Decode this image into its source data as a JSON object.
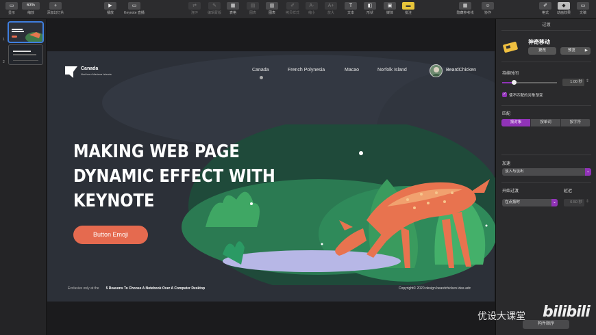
{
  "toolbar": {
    "items": [
      {
        "label": "显示",
        "icon": "view-icon"
      },
      {
        "label": "缩放",
        "value": "63%"
      },
      {
        "label": "添加幻灯片",
        "icon": "plus-icon"
      },
      {
        "label": "播放",
        "icon": "play-icon"
      },
      {
        "label": "Keynote 直播",
        "icon": "live-icon"
      },
      {
        "label": "连环",
        "icon": "loop-icon"
      },
      {
        "label": "编辑蒙版",
        "icon": "mask-icon"
      },
      {
        "label": "表格",
        "icon": "table-icon"
      },
      {
        "label": "图表",
        "icon": "chart-icon"
      },
      {
        "label": "图表",
        "icon": "chart-icon"
      },
      {
        "label": "拷贝样式",
        "icon": "copy-style-icon"
      },
      {
        "label": "缩小",
        "icon": "shrink-icon"
      },
      {
        "label": "放大",
        "icon": "grow-icon"
      },
      {
        "label": "文本",
        "icon": "text-icon"
      },
      {
        "label": "形状",
        "icon": "shape-icon"
      },
      {
        "label": "媒体",
        "icon": "media-icon"
      },
      {
        "label": "批注",
        "icon": "comment-icon"
      },
      {
        "label": "隐藏参考线",
        "icon": "guides-icon"
      },
      {
        "label": "协作",
        "icon": "collab-icon"
      },
      {
        "label": "格式",
        "icon": "format-icon"
      },
      {
        "label": "动画效果",
        "icon": "animate-icon"
      },
      {
        "label": "文稿",
        "icon": "document-icon"
      }
    ]
  },
  "slides": {
    "numbers": [
      "1",
      "2"
    ]
  },
  "slide": {
    "brand": {
      "name": "Canada",
      "sub": "Northern Mariana Islands"
    },
    "nav": [
      "Canada",
      "French Polynesia",
      "Macao",
      "Norfolk Island"
    ],
    "user": "BeardChicken",
    "headline": [
      "MAKING WEB PAGE",
      "DYNAMIC EFFECT WITH",
      "KEYNOTE"
    ],
    "cta": "Button Emoji",
    "footer_left": "Exclusive only at the",
    "footer_link": "5 Reasons To Choose A Notebook Over A Computer Desktop",
    "footer_right": "Copyright©  2020 design beardchicken idea adc"
  },
  "panel": {
    "title": "过渡",
    "effect_name": "神奇移动",
    "change": "更改",
    "preview": "预览",
    "duration_label": "持续时间",
    "duration_value": "1.00 秒",
    "fade_checkbox": "使不匹配的对象渐变",
    "fade_checked": true,
    "match_label": "匹配",
    "match_options": [
      "按对象",
      "按单词",
      "按字符"
    ],
    "match_selected": "按对象",
    "accel_label": "加速",
    "accel_value": "淡入与淡出",
    "start_label": "开始过渡",
    "delay_label": "延迟",
    "start_value": "在点按时",
    "delay_value": "0.50 秒",
    "build_order": "构件顺序"
  },
  "watermark": {
    "text": "优设大课堂",
    "brand": "bilibili"
  },
  "colors": {
    "accent": "#9133b8",
    "cta": "#e56a4f",
    "slide_bg": "#2c3038"
  }
}
